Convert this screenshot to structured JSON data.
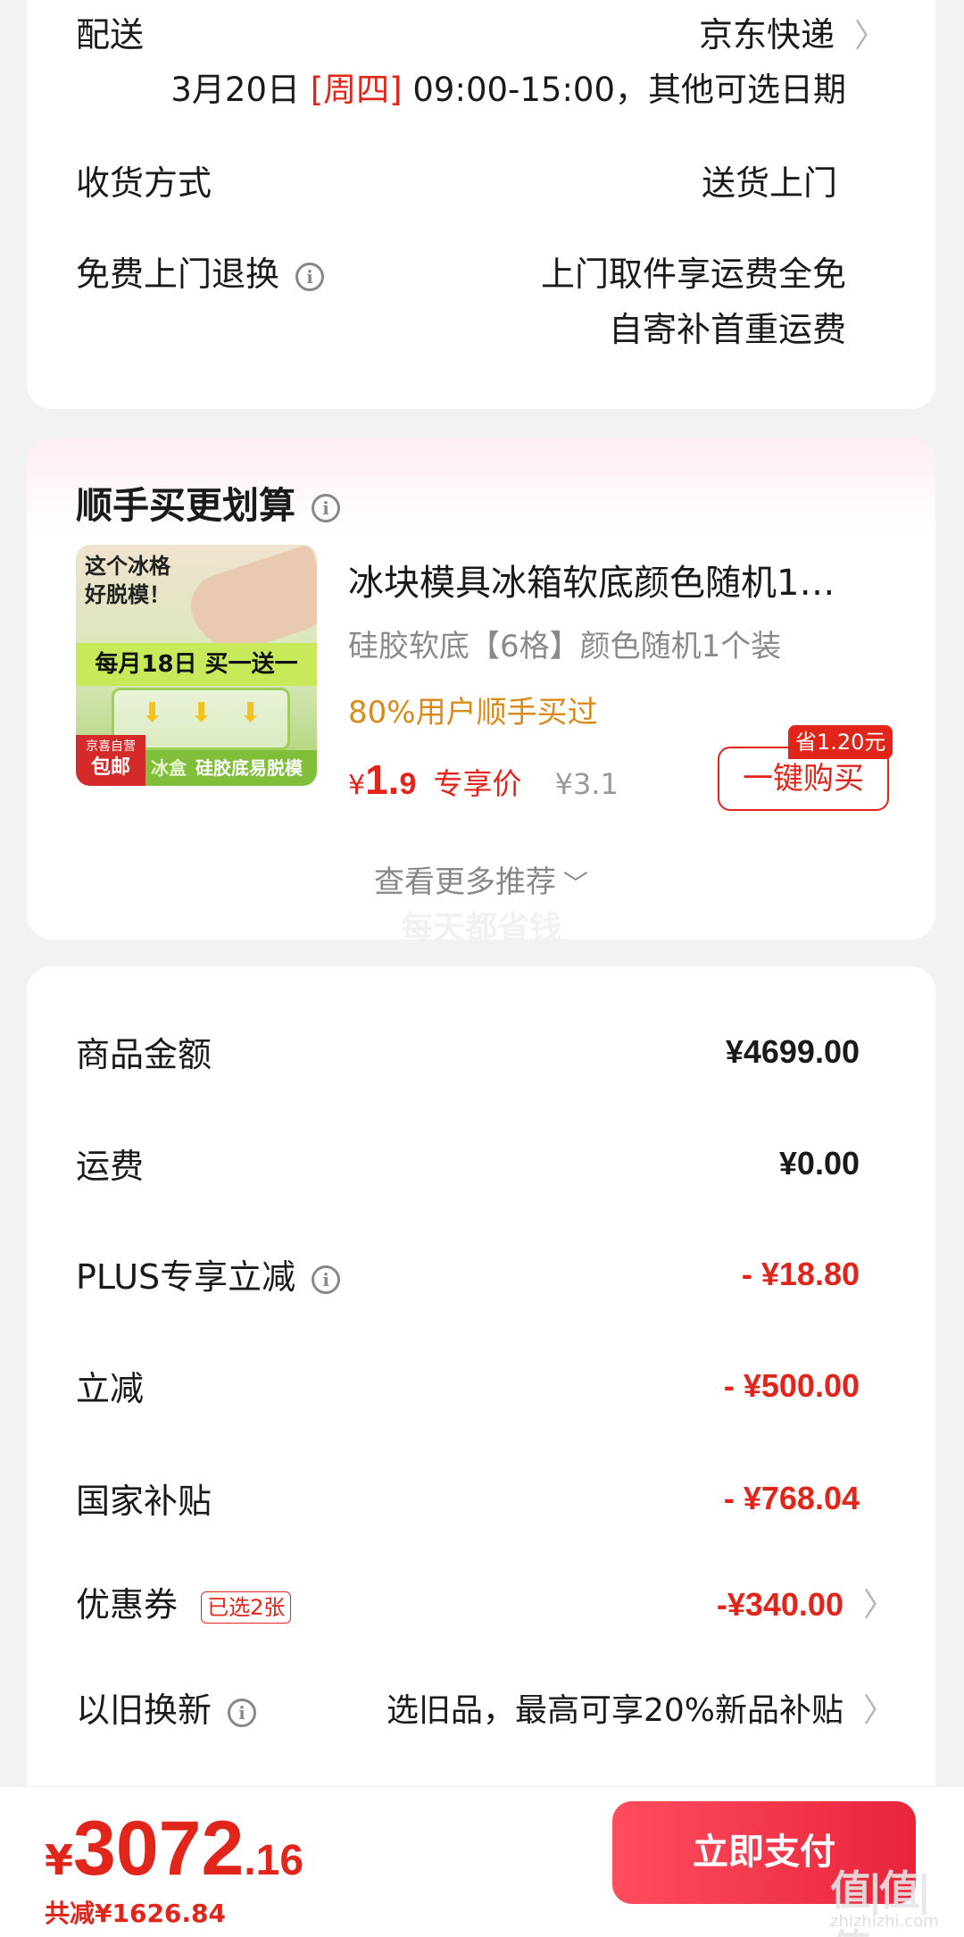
{
  "delivery": {
    "label": "配送",
    "carrier": "京东快递",
    "date": "3月20日",
    "weekday": "[周四]",
    "time_suffix": "09:00-15:00，其他可选日期",
    "receive_label": "收货方式",
    "receive_value": "送货上门",
    "return_label": "免费上门退换",
    "return_line1": "上门取件享运费全免",
    "return_line2": "自寄补首重运费"
  },
  "addon": {
    "title": "顺手买更划算",
    "product": {
      "image_text_top": "这个冰格\n好脱模！",
      "image_banner": "每月18日 买一送一",
      "image_badge_top": "京喜自营",
      "image_badge_bottom": "包邮",
      "image_bottom_text": "硅胶底易脱模",
      "image_bottom_left": "冰盒",
      "name": "冰块模具冰箱软底颜色随机1…",
      "spec": "硅胶软底【6格】颜色随机1个装",
      "social_proof": "80%用户顺手买过",
      "price_symbol": "¥",
      "price_int": "1.",
      "price_dec": "9",
      "price_label": "专享价",
      "orig_price": "¥3.1",
      "save_badge": "省1.20元",
      "buy_button": "一键购买"
    },
    "more": "查看更多推荐",
    "watermark": "每天都省钱"
  },
  "summary": {
    "rows": [
      {
        "label": "商品金额",
        "value": "¥4699.00"
      },
      {
        "label": "运费",
        "value": "¥0.00"
      },
      {
        "label": "PLUS专享立减",
        "value": "- ¥18.80"
      },
      {
        "label": "立减",
        "value": "- ¥500.00"
      },
      {
        "label": "国家补贴",
        "value": "- ¥768.04"
      },
      {
        "label": "优惠券",
        "tag": "已选2张",
        "value": "-¥340.00"
      },
      {
        "label": "以旧换新",
        "value": "选旧品，最高可享20%新品补贴"
      }
    ]
  },
  "footer": {
    "currency": "¥",
    "total_int": "3072",
    "total_dec": ".16",
    "saved": "共减¥1626.84",
    "pay_button": "立即支付",
    "watermark_logo": "值|值|值",
    "watermark_url": "zhizhizhi.com"
  },
  "colors": {
    "accent": "#e1251b",
    "orange": "#d98a1a",
    "pay_gradient_start": "#ff4d5e",
    "pay_gradient_end": "#e8243b"
  }
}
